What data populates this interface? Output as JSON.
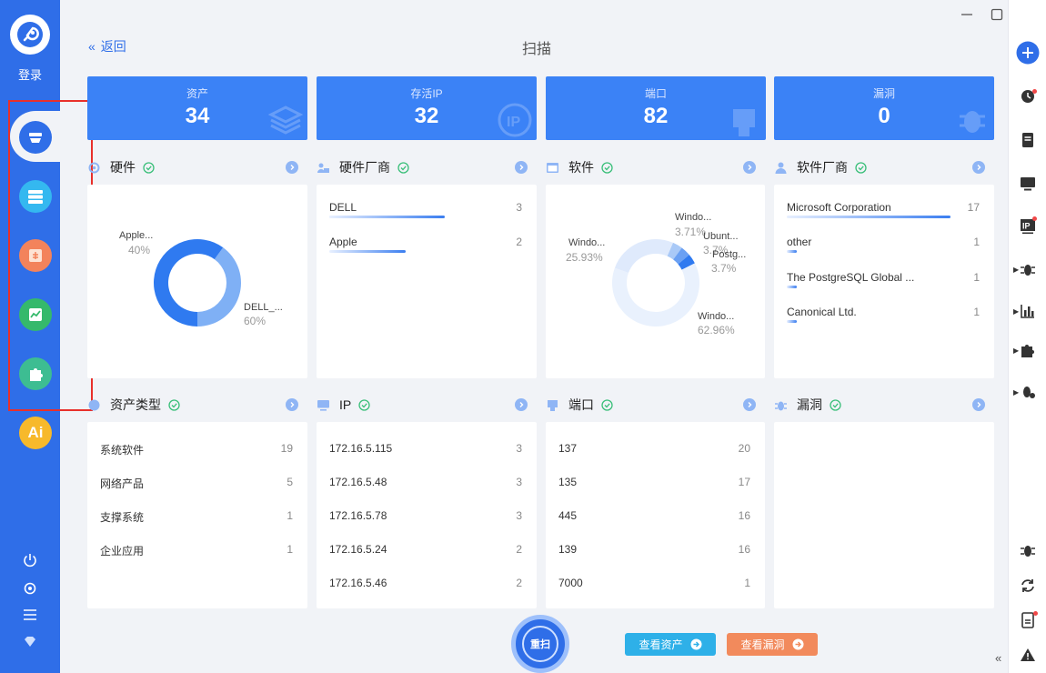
{
  "sidebar": {
    "login_label": "登录",
    "nav_items": [
      "asset-scan-icon",
      "server-list-icon",
      "vulnerability-icon",
      "chart-icon",
      "plugin-icon",
      "ai-icon"
    ],
    "ai_label": "Ai",
    "bottom_items": [
      "power-icon",
      "settings-icon",
      "menu-icon",
      "diamond-icon"
    ]
  },
  "header": {
    "back_label": "返回",
    "title": "扫描"
  },
  "stats": [
    {
      "label": "资产",
      "value": "34"
    },
    {
      "label": "存活IP",
      "value": "32"
    },
    {
      "label": "端口",
      "value": "82"
    },
    {
      "label": "漏洞",
      "value": "0"
    }
  ],
  "sections": {
    "hardware": {
      "title": "硬件",
      "chart_data": {
        "type": "pie",
        "labels": [
          "Apple...",
          "DELL_..."
        ],
        "percents": [
          "40%",
          "60%"
        ],
        "values": [
          40,
          60
        ],
        "colors": [
          "#7fb0f5",
          "#2f7af0"
        ]
      }
    },
    "hardware_vendor": {
      "title": "硬件厂商",
      "items": [
        {
          "name": "DELL",
          "count": "3",
          "ratio": 1.0
        },
        {
          "name": "Apple",
          "count": "2",
          "ratio": 0.66
        }
      ]
    },
    "software": {
      "title": "软件",
      "chart_data": {
        "type": "pie",
        "labels": [
          "Windo...",
          "Windo...",
          "Ubunt...",
          "Postg...",
          "Windo..."
        ],
        "percents": [
          "25.93%",
          "3.71%",
          "3.7%",
          "3.7%",
          "62.96%"
        ],
        "values": [
          25.93,
          3.71,
          3.7,
          3.7,
          62.96
        ],
        "colors": [
          "#dfeafc",
          "#a9c9f7",
          "#6aa0f3",
          "#2f7af0",
          "#e9f1fd"
        ]
      }
    },
    "software_vendor": {
      "title": "软件厂商",
      "items": [
        {
          "name": "Microsoft Corporation",
          "count": "17",
          "ratio": 1.0
        },
        {
          "name": "other",
          "count": "1",
          "ratio": 0.06
        },
        {
          "name": "The PostgreSQL Global ...",
          "count": "1",
          "ratio": 0.06
        },
        {
          "name": "Canonical Ltd.",
          "count": "1",
          "ratio": 0.06
        }
      ]
    },
    "asset_type": {
      "title": "资产类型",
      "items": [
        {
          "name": "系统软件",
          "count": "19"
        },
        {
          "name": "网络产品",
          "count": "5"
        },
        {
          "name": "支撑系统",
          "count": "1"
        },
        {
          "name": "企业应用",
          "count": "1"
        }
      ]
    },
    "ip": {
      "title": "IP",
      "items": [
        {
          "name": "172.16.5.115",
          "count": "3"
        },
        {
          "name": "172.16.5.48",
          "count": "3"
        },
        {
          "name": "172.16.5.78",
          "count": "3"
        },
        {
          "name": "172.16.5.24",
          "count": "2"
        },
        {
          "name": "172.16.5.46",
          "count": "2"
        }
      ]
    },
    "port": {
      "title": "端口",
      "items": [
        {
          "name": "137",
          "count": "20"
        },
        {
          "name": "135",
          "count": "17"
        },
        {
          "name": "445",
          "count": "16"
        },
        {
          "name": "139",
          "count": "16"
        },
        {
          "name": "7000",
          "count": "1"
        }
      ]
    },
    "vuln": {
      "title": "漏洞",
      "items": []
    }
  },
  "actions": {
    "rescan_label": "重扫",
    "view_assets_label": "查看资产",
    "view_vulns_label": "查看漏洞",
    "view_assets_color": "#2eb0e8",
    "view_vulns_color": "#f28a5c"
  },
  "right_bar": [
    "add-icon",
    "history-icon",
    "document-icon",
    "monitor-icon",
    "ip-icon",
    "bug-icon",
    "bar-chart-icon",
    "puzzle-icon",
    "bug-settings-icon",
    "bug-small-icon",
    "refresh-icon",
    "report-icon",
    "warning-icon"
  ],
  "accent": "#2f6ee8"
}
